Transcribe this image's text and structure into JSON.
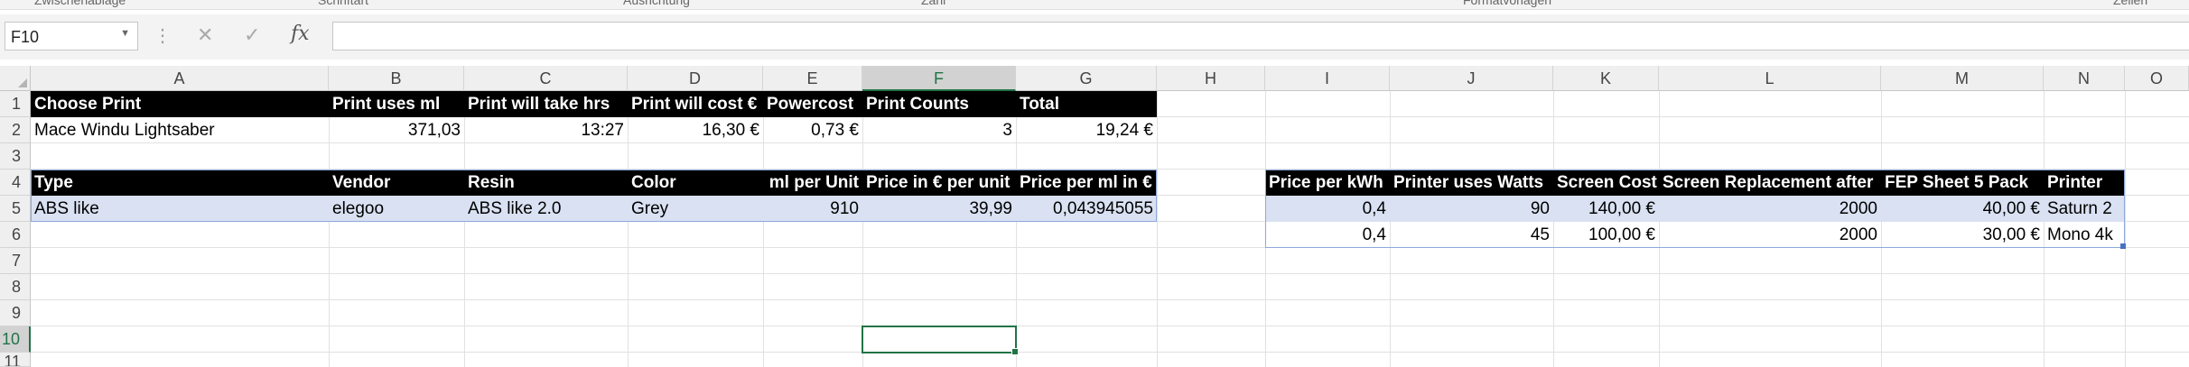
{
  "ribbon": {
    "groups": [
      "Zwischenablage",
      "Schriftart",
      "Ausrichtung",
      "Zahl",
      "Formatvorlagen",
      "Zellen"
    ]
  },
  "name_box": {
    "value": "F10"
  },
  "formula": {
    "fx_label": "fx",
    "value": ""
  },
  "columns": [
    "A",
    "B",
    "C",
    "D",
    "E",
    "F",
    "G",
    "H",
    "I",
    "J",
    "K",
    "L",
    "M",
    "N",
    "O"
  ],
  "rows": [
    "1",
    "2",
    "3",
    "4",
    "5",
    "6",
    "7",
    "8",
    "9",
    "10",
    "11"
  ],
  "print_table": {
    "headers": [
      "Choose Print",
      "Print uses ml",
      "Print will take hrs",
      "Print will cost €",
      "Powercost",
      "Print Counts",
      "Total"
    ],
    "values": [
      "Mace Windu Lightsaber",
      "371,03",
      "13:27",
      "16,30 €",
      "0,73 €",
      "3",
      "19,24 €"
    ]
  },
  "resin_table": {
    "headers": [
      "Type",
      "Vendor",
      "Resin",
      "Color",
      "ml per Unit",
      "Price in € per unit",
      "Price per ml in €"
    ],
    "rows": [
      [
        "ABS like",
        "elegoo",
        "ABS like 2.0",
        "Grey",
        "910",
        "39,99",
        "0,043945055"
      ]
    ]
  },
  "printer_table": {
    "headers": [
      "Price per kWh",
      "Printer uses Watts",
      "Screen Cost",
      "Screen Replacement after",
      "FEP Sheet 5 Pack",
      "Printer"
    ],
    "rows": [
      [
        "0,4",
        "90",
        "140,00 €",
        "2000",
        "40,00 €",
        "Saturn 2"
      ],
      [
        "0,4",
        "45",
        "100,00 €",
        "2000",
        "30,00 €",
        "Mono 4k"
      ]
    ]
  },
  "selection": {
    "cell": "F10",
    "column": "F",
    "row": "10"
  },
  "colors": {
    "header_bg": "#000000",
    "header_fg": "#ffffff",
    "table_tint": "#d9e1f2",
    "selection": "#217346"
  }
}
